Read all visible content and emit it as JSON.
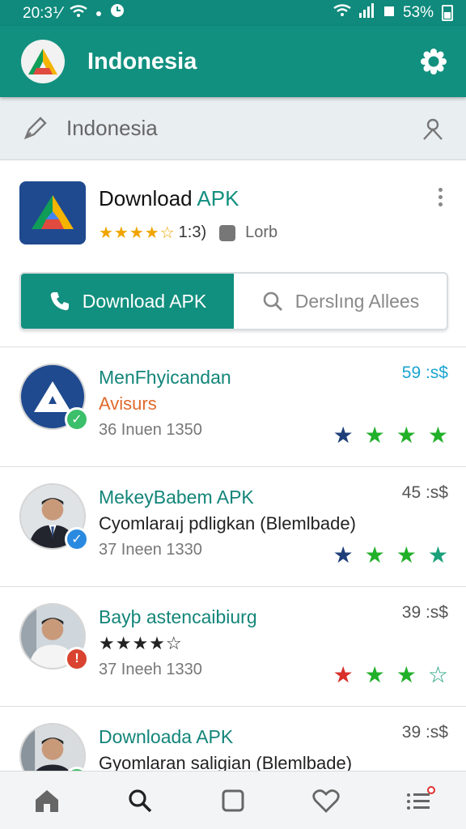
{
  "status_bar": {
    "time": "20:3⅟",
    "battery_percent": "53%"
  },
  "app_bar": {
    "title": "Indonesia"
  },
  "search": {
    "text": "Indonesia"
  },
  "featured": {
    "title_main": "Download ",
    "title_accent": "APK",
    "stars": "★★★★☆",
    "rating_count": "1:3)",
    "tag": "Lorb"
  },
  "tabs": [
    {
      "label": "Downloаd APK",
      "active": true
    },
    {
      "label": "Derslıng Allees",
      "active": false
    }
  ],
  "apps": [
    {
      "title": "MenFhyicandan",
      "subtitle": "Avisurs",
      "date": "36 Inuen 1350",
      "price": "59 :s$",
      "badge_icon": "check-icon",
      "badge_color": "#3bbf6a",
      "stars": [
        "#1e3f7a",
        "#22b02a",
        "#22b02a",
        "#22b02a"
      ]
    },
    {
      "title": "MekeyBabem APK",
      "subtitle": "Cyomlaraıj pdligkan (Blemlbade)",
      "date": "37 Ineen 1330",
      "price": "45 :s$",
      "badge_icon": "check-icon",
      "badge_color": "#2a8ae0",
      "stars": [
        "#1e3f7a",
        "#22b02a",
        "#22b02a",
        "#1aa07a"
      ]
    },
    {
      "title": "Bayþ astencaibiurg",
      "subtitle_stars": "★★★★☆",
      "date": "37 Ineeh 1330",
      "price": "39 :s$",
      "badge_icon": "alert-icon",
      "badge_color": "#d9432f",
      "stars": [
        "#d9302a",
        "#22b02a",
        "#22b02a",
        "outline"
      ]
    },
    {
      "title": "Downloada APK",
      "subtitle": "Gyomlaran saligian (Blemlbade)",
      "price": "39 :s$",
      "badge_icon": "check-icon",
      "badge_color": "#3bbf6a"
    }
  ],
  "colors": {
    "primary": "#12907f",
    "accent_orange": "#e06a2c",
    "star_gold": "#f0a500"
  },
  "bottom_nav": [
    "home-icon",
    "search-icon",
    "square-icon",
    "heart-icon",
    "list-icon"
  ]
}
